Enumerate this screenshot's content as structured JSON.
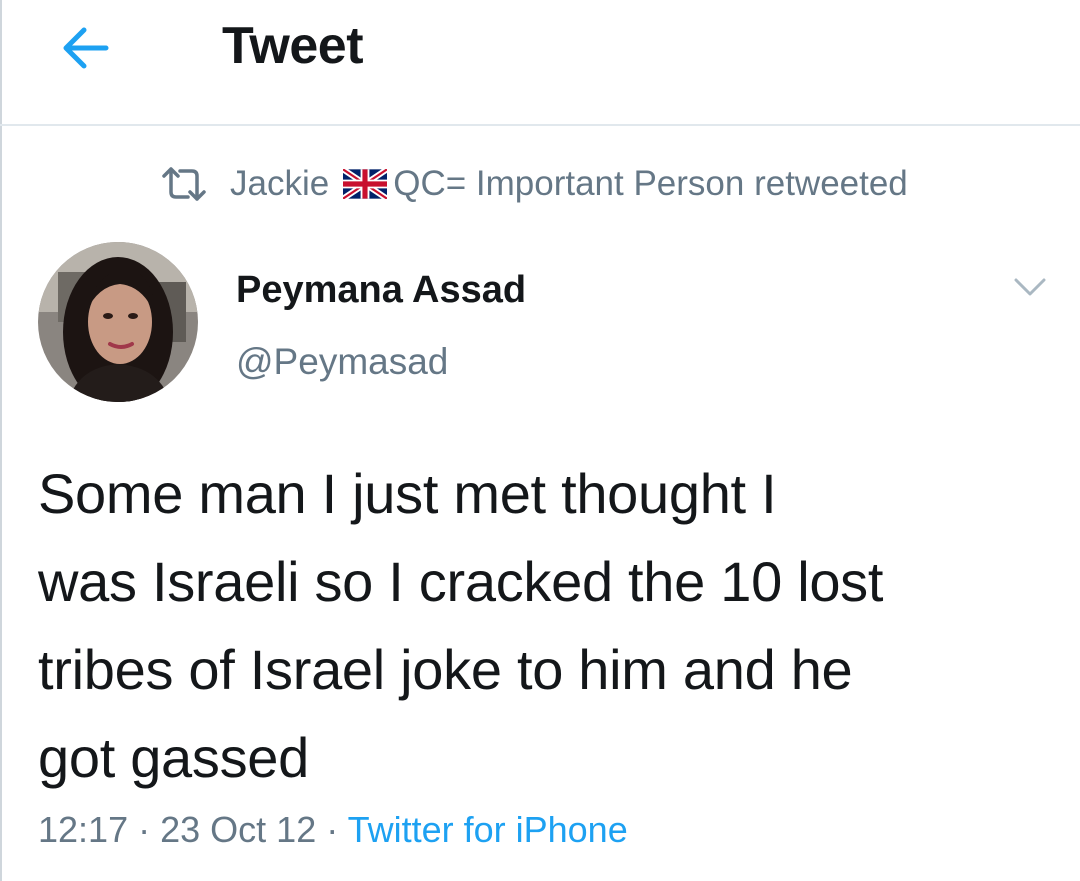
{
  "header": {
    "title": "Tweet",
    "back_icon": "arrow-left-icon",
    "accent_color": "#1da1f2"
  },
  "retweet": {
    "icon": "retweet-icon",
    "name_before_flag": "Jackie",
    "flag_icon": "union-jack-flag-icon",
    "name_after_flag": "QC= Important Person retweeted"
  },
  "tweet": {
    "author_name": "Peymana Assad",
    "author_handle": "@Peymasad",
    "menu_icon": "chevron-down-icon",
    "text_lines": [
      "Some man I just met thought I",
      "was Israeli so I cracked the 10 lost",
      "tribes of Israel joke to him and he",
      "got gassed"
    ],
    "time": "12:17",
    "separator": "·",
    "date": "23 Oct 12",
    "source": "Twitter for iPhone"
  }
}
